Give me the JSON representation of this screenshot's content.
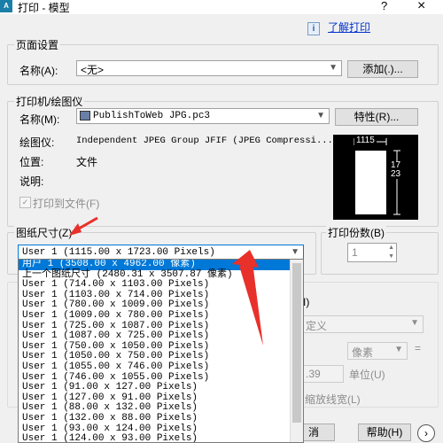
{
  "window": {
    "title": "打印 - 模型",
    "help_glyph": "?",
    "close_glyph": "×",
    "help_link": "了解打印",
    "info_glyph": "i"
  },
  "page_setup": {
    "group_title": "页面设置",
    "name_label": "名称(A):",
    "name_value": "<无>",
    "add_button": "添加(.)..."
  },
  "printer": {
    "group_title": "打印机/绘图仪",
    "name_label": "名称(M):",
    "name_value": "PublishToWeb JPG.pc3",
    "properties_button": "特性(R)...",
    "plotter_label": "绘图仪:",
    "plotter_value": "Independent JPEG Group JFIF (JPEG Compressi...",
    "location_label": "位置:",
    "location_value": "文件",
    "description_label": "说明:",
    "print_to_file": "打印到文件(F)",
    "preview_width": "1115",
    "preview_height": "1723"
  },
  "paper_size": {
    "group_title": "图纸尺寸(Z)",
    "selected": "User 1 (1115.00 x 1723.00 Pixels)",
    "options": [
      "用户 1 (3508.00 x 4962.00 像素)",
      "上一个图纸尺寸 (2480.31 x 3507.87 像素)",
      "User 1 (714.00 x 1103.00 Pixels)",
      "User 1 (1103.00 x 714.00 Pixels)",
      "User 1 (780.00 x 1009.00 Pixels)",
      "User 1 (1009.00 x 780.00 Pixels)",
      "User 1 (725.00 x 1087.00 Pixels)",
      "User 1 (1087.00 x 725.00 Pixels)",
      "User 1 (750.00 x 1050.00 Pixels)",
      "User 1 (1050.00 x 750.00 Pixels)",
      "User 1 (1055.00 x 746.00 Pixels)",
      "User 1 (746.00 x 1055.00 Pixels)",
      "User 1 (91.00 x 127.00 Pixels)",
      "User 1 (127.00 x 91.00 Pixels)",
      "User 1 (88.00 x 132.00 Pixels)",
      "User 1 (132.00 x 88.00 Pixels)",
      "User 1 (93.00 x 124.00 Pixels)",
      "User 1 (124.00 x 93.00 Pixels)"
    ]
  },
  "copies": {
    "group_title": "打印份数(B)",
    "value": "1"
  },
  "right_partial": {
    "paren_i": "I)",
    "defined": "定义",
    "pixels": "像素",
    "scale_value": ".39",
    "unit": "单位(U)",
    "linewidth": "缩放线宽(L)"
  },
  "footer": {
    "partial_btn": "消",
    "help_btn": "帮助(H)"
  }
}
